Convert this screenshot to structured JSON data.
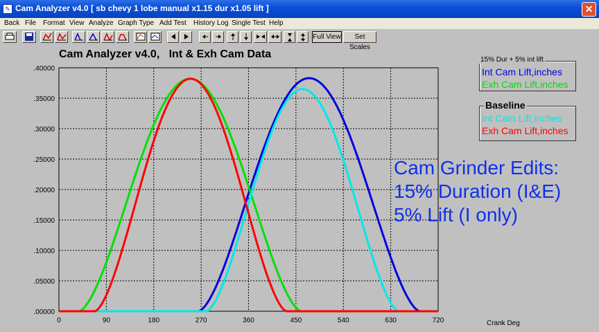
{
  "window": {
    "title": "Cam Analyzer v4.0  [ sb chevy 1 lobe manual x1.15 dur x1.05 lift ]",
    "close_glyph": "✕"
  },
  "menu": [
    "Back",
    "File",
    "Format",
    "View",
    "Analyze",
    "Graph Type",
    "Add Test",
    "History Log",
    "Single Test",
    "Help"
  ],
  "toolbar": {
    "full_view_label": "Full View",
    "set_scales_label": "Set Scales"
  },
  "chart_data": {
    "type": "line",
    "title": "Cam Analyzer v4.0,   Int & Exh Cam Data",
    "xlabel": "Crank Deg",
    "ylabel": "",
    "xlim": [
      0,
      720
    ],
    "ylim": [
      0,
      0.4
    ],
    "x_ticks": [
      "0",
      "90",
      "180",
      "270",
      "360",
      "450",
      "540",
      "630",
      "720"
    ],
    "y_ticks": [
      ".00000",
      ".05000",
      ".10000",
      ".15000",
      ".20000",
      ".25000",
      ".30000",
      ".35000",
      ".40000"
    ],
    "grid": true,
    "series": [
      {
        "name": "Int Cam Lift,inches",
        "group": "15% Dur + 5% int lift",
        "color": "#0000e0",
        "open": 265,
        "close": 685,
        "peak": 0.383
      },
      {
        "name": "Exh Cam Lift,inches",
        "group": "15% Dur + 5% int lift",
        "color": "#00e000",
        "open": 38,
        "close": 460,
        "peak": 0.382
      },
      {
        "name": "Int Cam Lift,inches",
        "group": "Baseline",
        "color": "#00e8e8",
        "open": 280,
        "close": 645,
        "peak": 0.365
      },
      {
        "name": "Exh Cam Lift,inches",
        "group": "Baseline",
        "color": "#ff0000",
        "open": 68,
        "close": 432,
        "peak": 0.382
      }
    ]
  },
  "legend": {
    "group1_title": "15% Dur + 5% int lift",
    "group2_title": "Baseline"
  },
  "annotation": {
    "line1": "Cam Grinder Edits:",
    "line2": "15% Duration (I&E)",
    "line3": "5% Lift (I only)"
  }
}
